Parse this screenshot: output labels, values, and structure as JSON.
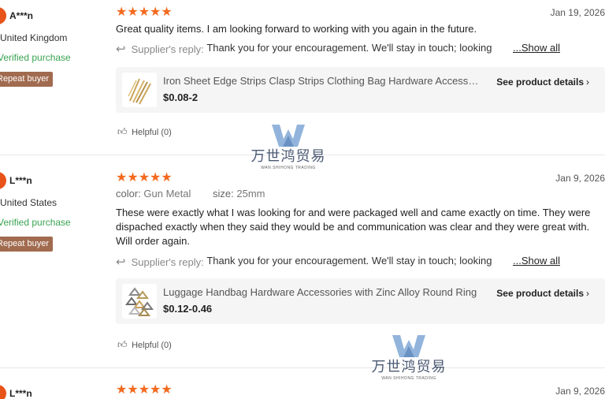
{
  "reviews": [
    {
      "buyer_name": "A***n",
      "country": "United Kingdom",
      "verified": "Verified purchase",
      "badge": "Repeat buyer",
      "stars": "★★★★★",
      "rating": 5,
      "date": "Jan 19, 2026",
      "text": "Great quality items. I am looking forward to working with you again in the future.",
      "reply_label": "Supplier's reply:",
      "reply_text": "Thank you for your encouragement. We'll stay in touch; looking",
      "show_all": "...Show all",
      "product": {
        "name": "Iron Sheet Edge Strips Clasp Strips Clothing Bag Hardware Accessories",
        "price": "$0.08-2",
        "details": "See product details"
      },
      "helpful": "Helpful (0)"
    },
    {
      "buyer_name": "L***n",
      "country": "United States",
      "verified": "Verified purchase",
      "badge": "Repeat buyer",
      "stars": "★★★★★",
      "rating": 5,
      "date": "Jan 9, 2026",
      "attr_color_label": "color:",
      "attr_color_value": "Gun Metal",
      "attr_size_label": "size:",
      "attr_size_value": "25mm",
      "text": "These were exactly what I was looking for and were packaged well and came exactly on time.  They were dispached exactly when they said they would be and communication was clear and they were great with. Will order again.",
      "reply_label": "Supplier's reply:",
      "reply_text": "Thank you for your encouragement. We'll stay in touch; looking",
      "show_all": "...Show all",
      "product": {
        "name": "Luggage Handbag Hardware Accessories with Zinc Alloy Round Ring",
        "price": "$0.12-0.46",
        "details": "See product details"
      },
      "helpful": "Helpful (0)"
    },
    {
      "buyer_name": "L***n",
      "stars": "★★★★★",
      "rating": 5,
      "date": "Jan 9, 2026"
    }
  ],
  "watermark": {
    "cn": "万世鸿贸易",
    "en": "WAN SHIHONG TRADING"
  },
  "colors": {
    "star": "#f36a1f",
    "verified": "#3aa351",
    "badge": "#a16b4f",
    "avatar": "#e8531a"
  }
}
